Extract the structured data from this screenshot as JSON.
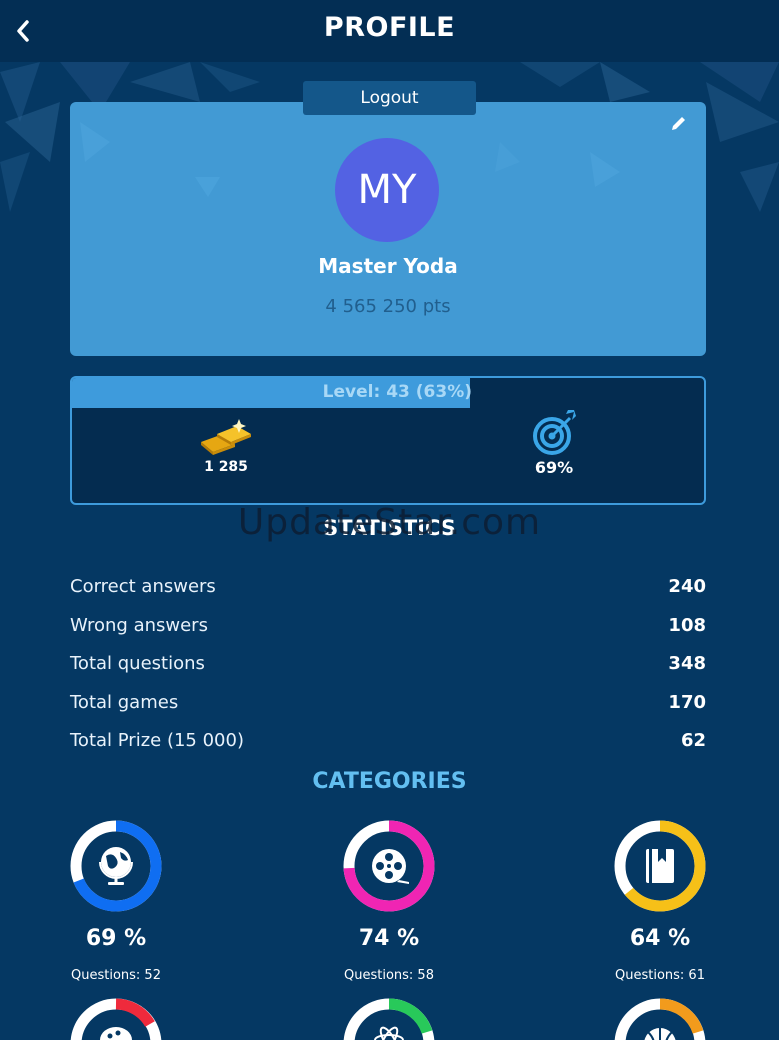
{
  "header": {
    "title": "PROFILE"
  },
  "profile": {
    "logout_label": "Logout",
    "initials": "MY",
    "name": "Master Yoda",
    "points": "4 565 250 pts",
    "avatar_color": "#5362e3",
    "card_color": "#429ad4"
  },
  "level": {
    "label": "Level: 43 (63%)",
    "progress": 0.63,
    "gold": "1 285",
    "accuracy": "69%"
  },
  "watermark": "UpdateStar.com",
  "statistics": {
    "title": "STATISTICS",
    "rows": [
      {
        "label": "Correct answers",
        "value": "240"
      },
      {
        "label": "Wrong answers",
        "value": "108"
      },
      {
        "label": "Total questions",
        "value": "348"
      },
      {
        "label": "Total games",
        "value": "170"
      },
      {
        "label": "Total Prize (15 000)",
        "value": "62"
      }
    ]
  },
  "categories": {
    "title": "CATEGORIES",
    "items": [
      {
        "icon": "globe-icon",
        "percent_label": "69 %",
        "percent": 0.69,
        "questions_label": "Questions: 52",
        "color": "#0f6ef2"
      },
      {
        "icon": "film-reel-icon",
        "percent_label": "74 %",
        "percent": 0.74,
        "questions_label": "Questions: 58",
        "color": "#f025b3"
      },
      {
        "icon": "book-icon",
        "percent_label": "64 %",
        "percent": 0.64,
        "questions_label": "Questions: 61",
        "color": "#f6c018"
      }
    ],
    "partial_colors": [
      "#ef2a3c",
      "#28c95a",
      "#f29b1c"
    ]
  }
}
